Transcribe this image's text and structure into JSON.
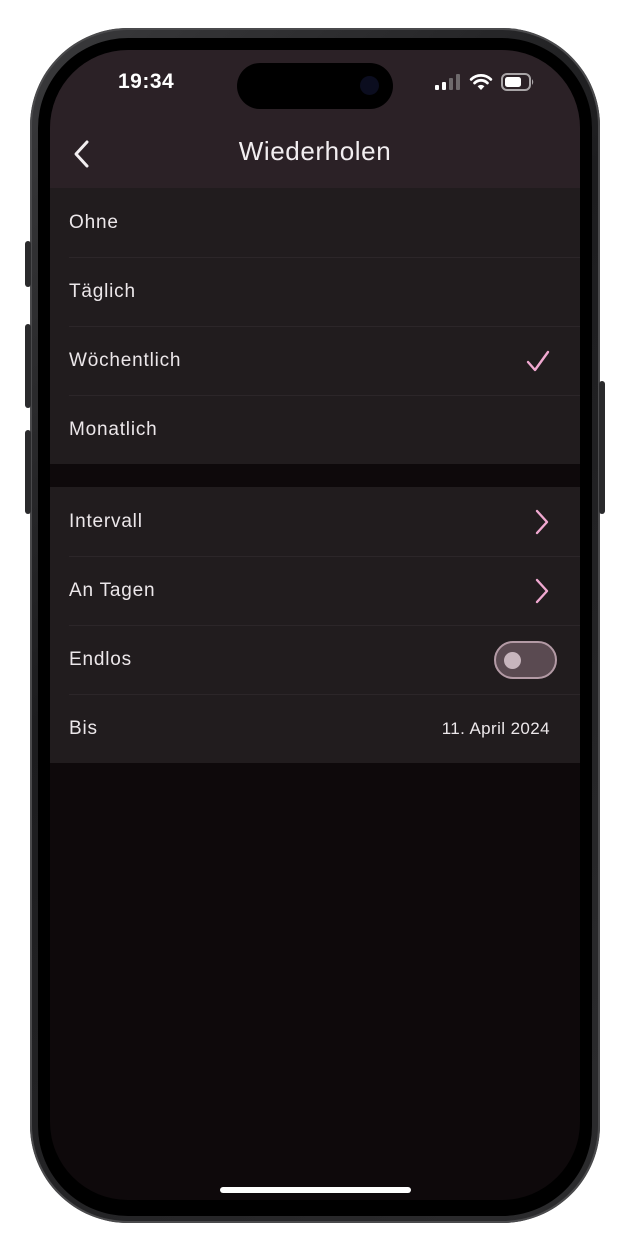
{
  "status_bar": {
    "time": "19:34"
  },
  "nav": {
    "title": "Wiederholen",
    "back_icon": "chevron-left-icon"
  },
  "frequency": {
    "options": [
      {
        "label": "Ohne",
        "selected": false
      },
      {
        "label": "Täglich",
        "selected": false
      },
      {
        "label": "Wöchentlich",
        "selected": true
      },
      {
        "label": "Monatlich",
        "selected": false
      }
    ]
  },
  "settings": {
    "interval_label": "Intervall",
    "days_label": "An Tagen",
    "endless_label": "Endlos",
    "endless_on": false,
    "until_label": "Bis",
    "until_value": "11. April 2024"
  },
  "colors": {
    "accent": "#f0a8d0",
    "background": "#0e090b",
    "group_background": "#211c1e",
    "header_background": "#2b2126"
  }
}
